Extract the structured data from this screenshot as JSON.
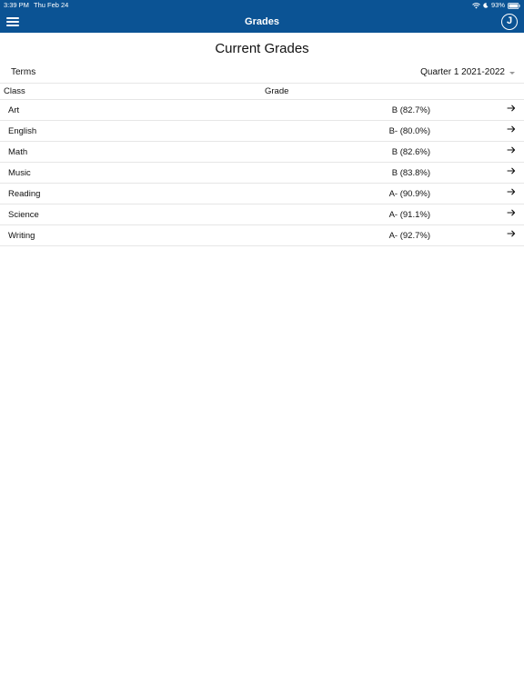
{
  "status": {
    "time": "3:39 PM",
    "date": "Thu Feb 24",
    "battery": "93%",
    "icons": [
      "wifi-icon",
      "moon-icon",
      "battery-icon"
    ]
  },
  "nav": {
    "title": "Grades",
    "avatar_initial": "J",
    "menu_icon": "hamburger-menu-icon"
  },
  "page": {
    "title": "Current Grades"
  },
  "terms": {
    "label": "Terms",
    "selected": "Quarter 1 2021-2022"
  },
  "table": {
    "headers": [
      "Class",
      "Grade"
    ],
    "rows": [
      {
        "class": "Art",
        "grade": "B (82.7%)"
      },
      {
        "class": "English",
        "grade": "B- (80.0%)"
      },
      {
        "class": "Math",
        "grade": "B (82.6%)"
      },
      {
        "class": "Music",
        "grade": "B (83.8%)"
      },
      {
        "class": "Reading",
        "grade": "A- (90.9%)"
      },
      {
        "class": "Science",
        "grade": "A- (91.1%)"
      },
      {
        "class": "Writing",
        "grade": "A- (92.7%)"
      }
    ]
  },
  "colors": {
    "brand": "#0b5394",
    "divider": "#e6e6e6"
  }
}
